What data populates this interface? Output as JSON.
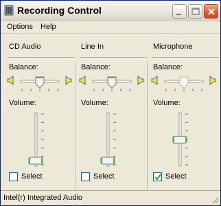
{
  "window": {
    "title": "Recording Control"
  },
  "titlebar_buttons": {
    "minimize": "minimize-icon",
    "maximize": "maximize-icon",
    "close": "close-icon"
  },
  "menu": [
    {
      "label": "Options"
    },
    {
      "label": "Help"
    }
  ],
  "columns": [
    {
      "name": "CD Audio",
      "balance_label": "Balance:",
      "volume_label": "Volume:",
      "select_label": "Select",
      "selected": false,
      "balance": 0.5,
      "volume": 0.0,
      "enabled": true
    },
    {
      "name": "Line In",
      "balance_label": "Balance:",
      "volume_label": "Volume:",
      "select_label": "Select",
      "selected": false,
      "balance": 0.5,
      "volume": 0.0,
      "enabled": true
    },
    {
      "name": "Microphone",
      "balance_label": "Balance:",
      "volume_label": "Volume:",
      "select_label": "Select",
      "selected": true,
      "balance": 0.5,
      "volume": 0.45,
      "enabled": false
    }
  ],
  "status": {
    "text": "Intel(r) Integrated Audio"
  },
  "colors": {
    "accent_green": "#49b84a",
    "check_green": "#21a121",
    "title_text": "#000000"
  }
}
